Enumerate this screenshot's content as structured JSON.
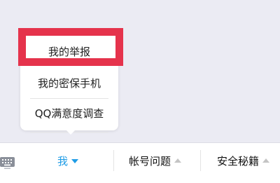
{
  "popup_menu": {
    "items": [
      {
        "label": "我的举报",
        "highlighted": true
      },
      {
        "label": "我的密保手机",
        "highlighted": false
      },
      {
        "label": "QQ满意度调查",
        "highlighted": false
      }
    ],
    "highlight_color": "#e5334c"
  },
  "bottom_bar": {
    "keyboard_icon": "keyboard-icon",
    "tabs": [
      {
        "label": "我",
        "active": true,
        "arrow": "caret-down-icon"
      },
      {
        "label": "帐号问题",
        "active": false,
        "arrow": "caret-up-icon"
      },
      {
        "label": "安全秘籍",
        "active": false,
        "arrow": "caret-up-icon"
      }
    ],
    "active_color": "#1e9ce6"
  }
}
